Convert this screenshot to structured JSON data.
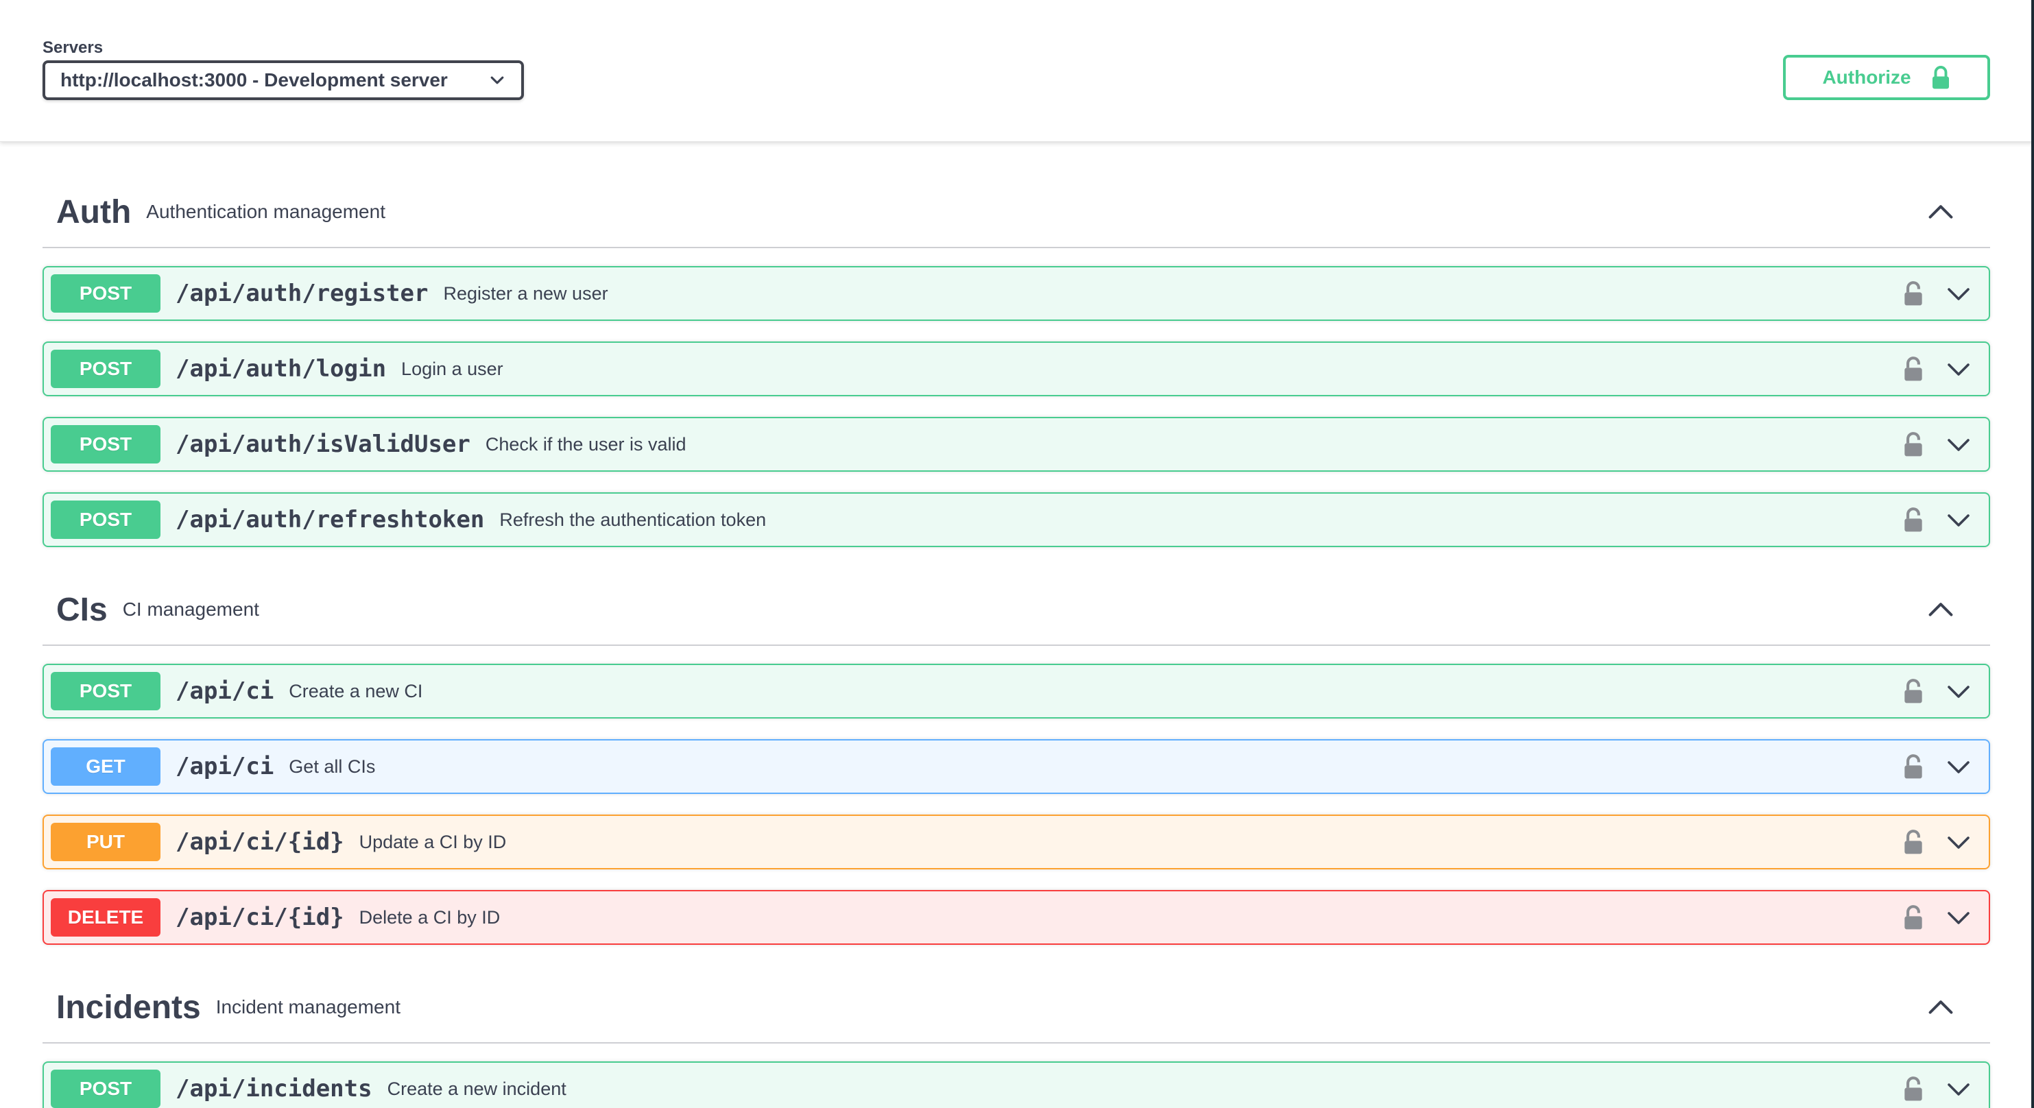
{
  "servers": {
    "label": "Servers",
    "selected": "http://localhost:3000 - Development server"
  },
  "authorize": {
    "label": "Authorize"
  },
  "tags": [
    {
      "name": "Auth",
      "description": "Authentication management",
      "operations": [
        {
          "method": "POST",
          "path": "/api/auth/register",
          "summary": "Register a new user"
        },
        {
          "method": "POST",
          "path": "/api/auth/login",
          "summary": "Login a user"
        },
        {
          "method": "POST",
          "path": "/api/auth/isValidUser",
          "summary": "Check if the user is valid"
        },
        {
          "method": "POST",
          "path": "/api/auth/refreshtoken",
          "summary": "Refresh the authentication token"
        }
      ]
    },
    {
      "name": "CIs",
      "description": "CI management",
      "operations": [
        {
          "method": "POST",
          "path": "/api/ci",
          "summary": "Create a new CI"
        },
        {
          "method": "GET",
          "path": "/api/ci",
          "summary": "Get all CIs"
        },
        {
          "method": "PUT",
          "path": "/api/ci/{id}",
          "summary": "Update a CI by ID"
        },
        {
          "method": "DELETE",
          "path": "/api/ci/{id}",
          "summary": "Delete a CI by ID"
        }
      ]
    },
    {
      "name": "Incidents",
      "description": "Incident management",
      "operations": [
        {
          "method": "POST",
          "path": "/api/incidents",
          "summary": "Create a new incident"
        }
      ]
    }
  ],
  "colors": {
    "post": "#49cc90",
    "get": "#61affe",
    "put": "#fca130",
    "delete": "#f93e3e",
    "text": "#3b4151"
  },
  "icons": {
    "server_select": "chevron-down-icon",
    "authorize": "lock-icon",
    "tag_toggle": "chevron-up-icon",
    "operation_lock": "lock-icon",
    "operation_expand": "chevron-down-icon"
  }
}
